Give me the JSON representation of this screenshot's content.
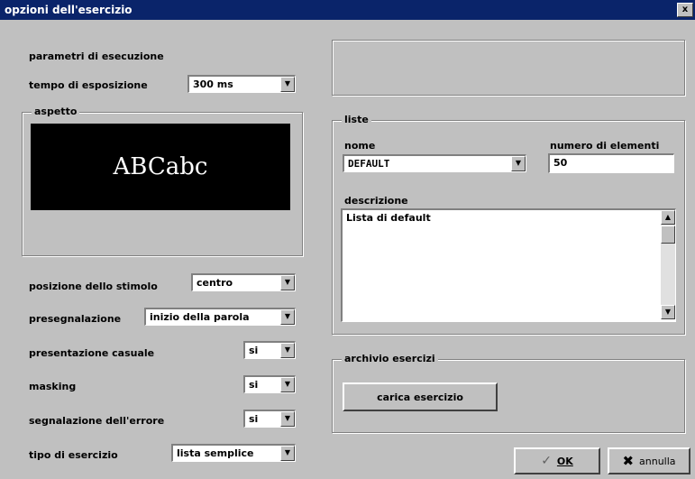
{
  "window": {
    "title": "opzioni dell'esercizio",
    "close_label": "x"
  },
  "left": {
    "group_title": "parametri di esecuzione",
    "exposure_label": "tempo di esposizione",
    "exposure_value": "300 ms",
    "aspect_title": "aspetto",
    "preview_text": "ABCabc",
    "position_label": "posizione dello stimolo",
    "position_value": "centro",
    "presignal_label": "presegnalazione",
    "presignal_value": "inizio della parola",
    "random_label": "presentazione casuale",
    "random_value": "si",
    "masking_label": "masking",
    "masking_value": "si",
    "error_label": "segnalazione dell'errore",
    "error_value": "si",
    "type_label": "tipo di esercizio",
    "type_value": "lista semplice"
  },
  "list": {
    "group_title": "liste",
    "name_label": "nome",
    "name_value": "DEFAULT",
    "count_label": "numero di elementi",
    "count_value": "50",
    "desc_label": "descrizione",
    "desc_value": "Lista di default"
  },
  "archive": {
    "group_title": "archivio esercizi",
    "load_button": "carica esercizio"
  },
  "buttons": {
    "ok": "OK",
    "cancel": "annulla"
  },
  "icons": {
    "dropdown": "chevron-down-icon",
    "ok": "check-icon",
    "cancel": "x-icon"
  }
}
